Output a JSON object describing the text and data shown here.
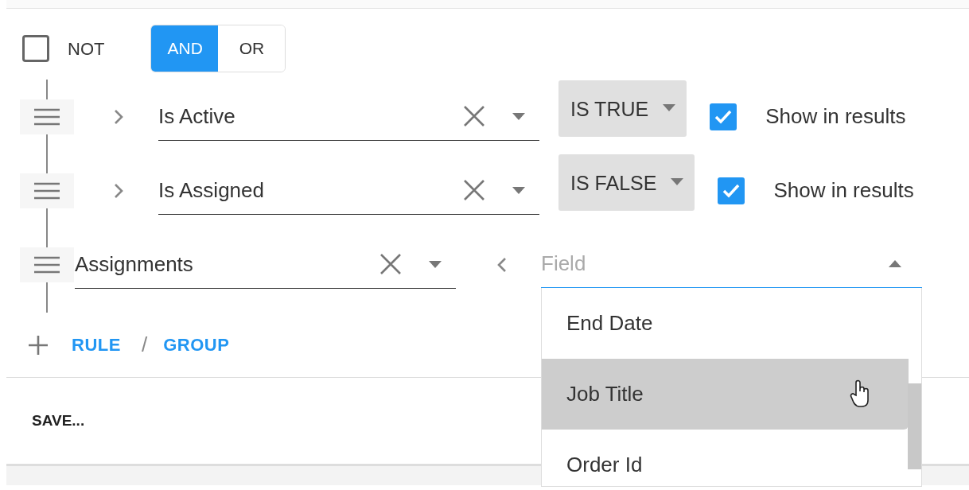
{
  "not_toggle": {
    "label": "NOT",
    "checked": false
  },
  "combinator": [
    {
      "label": "AND",
      "selected": true
    },
    {
      "label": "OR",
      "selected": false
    }
  ],
  "rules": [
    {
      "kind": "rule",
      "field": "Is Active",
      "expanded": false,
      "operator": "IS TRUE",
      "show_in_results": {
        "label": "Show in results",
        "checked": true
      }
    },
    {
      "kind": "rule",
      "field": "Is Assigned",
      "expanded": false,
      "operator": "IS FALSE",
      "show_in_results": {
        "label": "Show in results",
        "checked": true
      }
    },
    {
      "kind": "group",
      "field": "Assignments",
      "subfield": {
        "placeholder": "Field",
        "expanded": true,
        "options": [
          {
            "label": "End Date",
            "selected": false
          },
          {
            "label": "Job Title",
            "selected": true
          },
          {
            "label": "Order Id",
            "selected": false
          }
        ]
      }
    }
  ],
  "add": {
    "rule": "RULE",
    "separator": "/",
    "group": "GROUP"
  },
  "save_button": "SAVE..."
}
